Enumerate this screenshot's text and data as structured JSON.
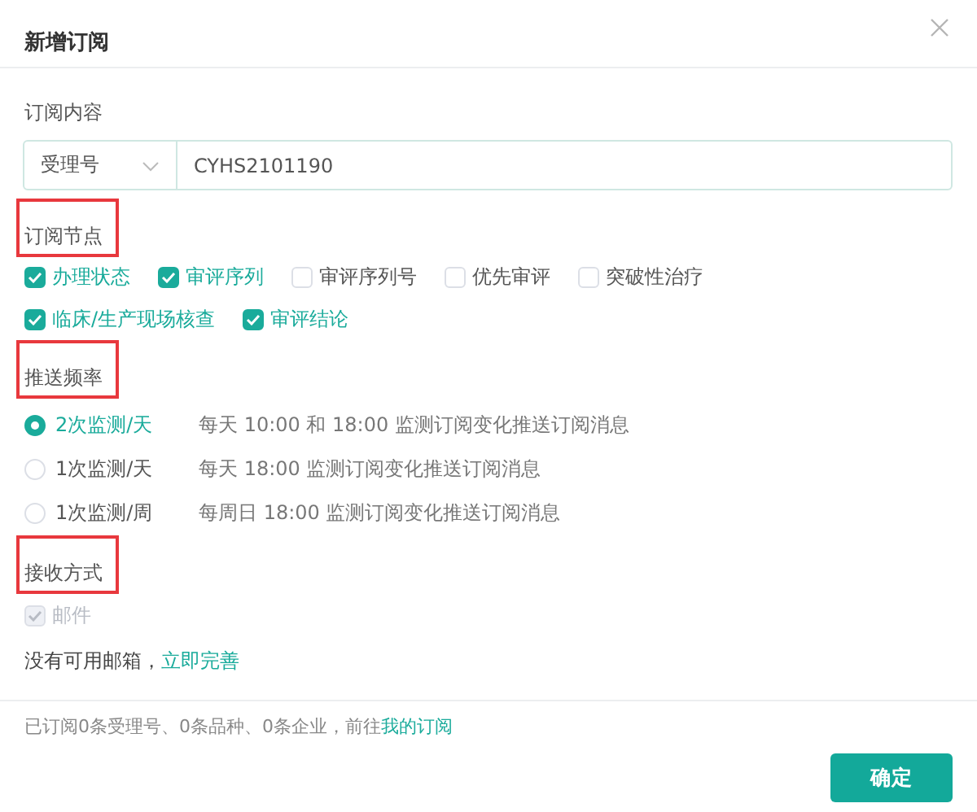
{
  "dialog": {
    "title": "新增订阅"
  },
  "content": {
    "label": "订阅内容",
    "type_select": "受理号",
    "query": "CYHS2101190"
  },
  "nodes": {
    "label": "订阅节点",
    "highlighted": true,
    "options": [
      {
        "label": "办理状态",
        "checked": true
      },
      {
        "label": "审评序列",
        "checked": true
      },
      {
        "label": "审评序列号",
        "checked": false
      },
      {
        "label": "优先审评",
        "checked": false
      },
      {
        "label": "突破性治疗",
        "checked": false
      },
      {
        "label": "临床/生产现场核查",
        "checked": true
      },
      {
        "label": "审评结论",
        "checked": true
      }
    ]
  },
  "frequency": {
    "label": "推送频率",
    "highlighted": true,
    "options": [
      {
        "label": "2次监测/天",
        "description": "每天 10:00 和 18:00 监测订阅变化推送订阅消息",
        "selected": true
      },
      {
        "label": "1次监测/天",
        "description": "每天 18:00 监测订阅变化推送订阅消息",
        "selected": false
      },
      {
        "label": "1次监测/周",
        "description": "每周日 18:00 监测订阅变化推送订阅消息",
        "selected": false
      }
    ]
  },
  "delivery": {
    "label": "接收方式",
    "highlighted": true,
    "options": [
      {
        "label": "邮件",
        "checked": true,
        "disabled": true
      }
    ],
    "notice": "没有可用邮箱，",
    "notice_link": "立即完善"
  },
  "footer": {
    "summary": "已订阅0条受理号、0条品种、0条企业，前往",
    "summary_link": "我的订阅",
    "confirm": "确定"
  }
}
